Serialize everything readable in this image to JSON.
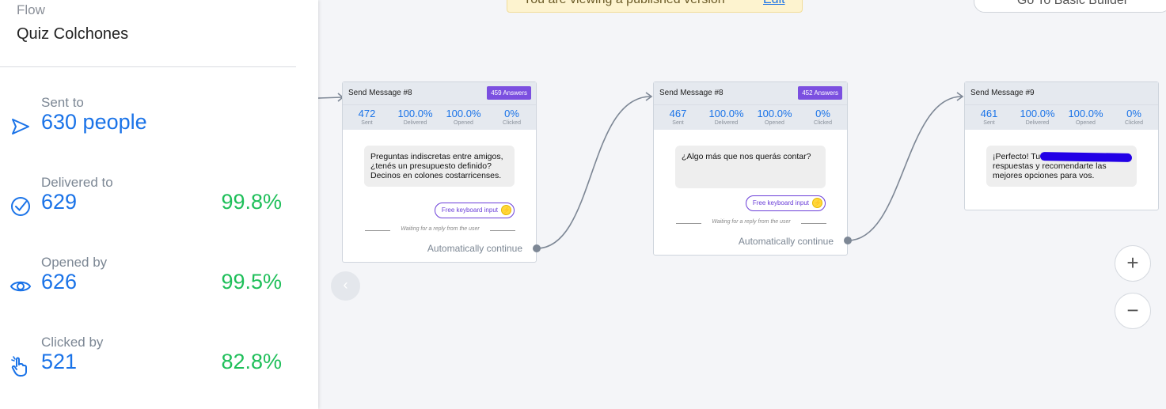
{
  "sidebar": {
    "flow_label": "Flow",
    "flow_name": "Quiz Colchones",
    "stats": [
      {
        "label": "Sent to",
        "value": "630 people",
        "percent": "",
        "icon": "send-icon"
      },
      {
        "label": "Delivered to",
        "value": "629",
        "percent": "99.8%",
        "icon": "check-circle-icon"
      },
      {
        "label": "Opened by",
        "value": "626",
        "percent": "99.5%",
        "icon": "eye-icon"
      },
      {
        "label": "Clicked by",
        "value": "521",
        "percent": "82.8%",
        "icon": "hand-pointer-icon"
      }
    ]
  },
  "banner": {
    "text": "You are viewing a published version",
    "edit_label": "Edit"
  },
  "top_button": {
    "label": "Go To Basic Builder"
  },
  "nodes": [
    {
      "title": "Send Message #8",
      "answers": "459 Answers",
      "metrics": [
        {
          "value": "472",
          "label": "Sent"
        },
        {
          "value": "100.0%",
          "label": "Delivered"
        },
        {
          "value": "100.0%",
          "label": "Opened"
        },
        {
          "value": "0%",
          "label": "Clicked"
        }
      ],
      "message": "Preguntas indiscretas entre amigos, ¿tenés un presupuesto definido? Decinos en colones costarricenses.",
      "keyboard_label": "Free keyboard input",
      "waiting_text": "Waiting for a reply from the user",
      "continue_label": "Automatically continue"
    },
    {
      "title": "Send Message #8",
      "answers": "452 Answers",
      "metrics": [
        {
          "value": "467",
          "label": "Sent"
        },
        {
          "value": "100.0%",
          "label": "Delivered"
        },
        {
          "value": "100.0%",
          "label": "Opened"
        },
        {
          "value": "0%",
          "label": "Clicked"
        }
      ],
      "message": "¿Algo más que nos querás contar?",
      "keyboard_label": "Free keyboard input",
      "waiting_text": "Waiting for a reply from the user",
      "continue_label": "Automatically continue"
    },
    {
      "title": "Send Message #9",
      "metrics": [
        {
          "value": "461",
          "label": "Sent"
        },
        {
          "value": "100.0%",
          "label": "Delivered"
        },
        {
          "value": "100.0%",
          "label": "Opened"
        },
        {
          "value": "0%",
          "label": "Clicked"
        }
      ],
      "message": "¡Perfecto! Tu va a analizar tus respuestas y recomendarte las mejores opciones para vos."
    }
  ],
  "zoom": {
    "in_label": "+",
    "out_label": "−"
  },
  "colors": {
    "accent": "#1a73e8",
    "success": "#1fbf5a",
    "badge": "#7b4fe0"
  }
}
